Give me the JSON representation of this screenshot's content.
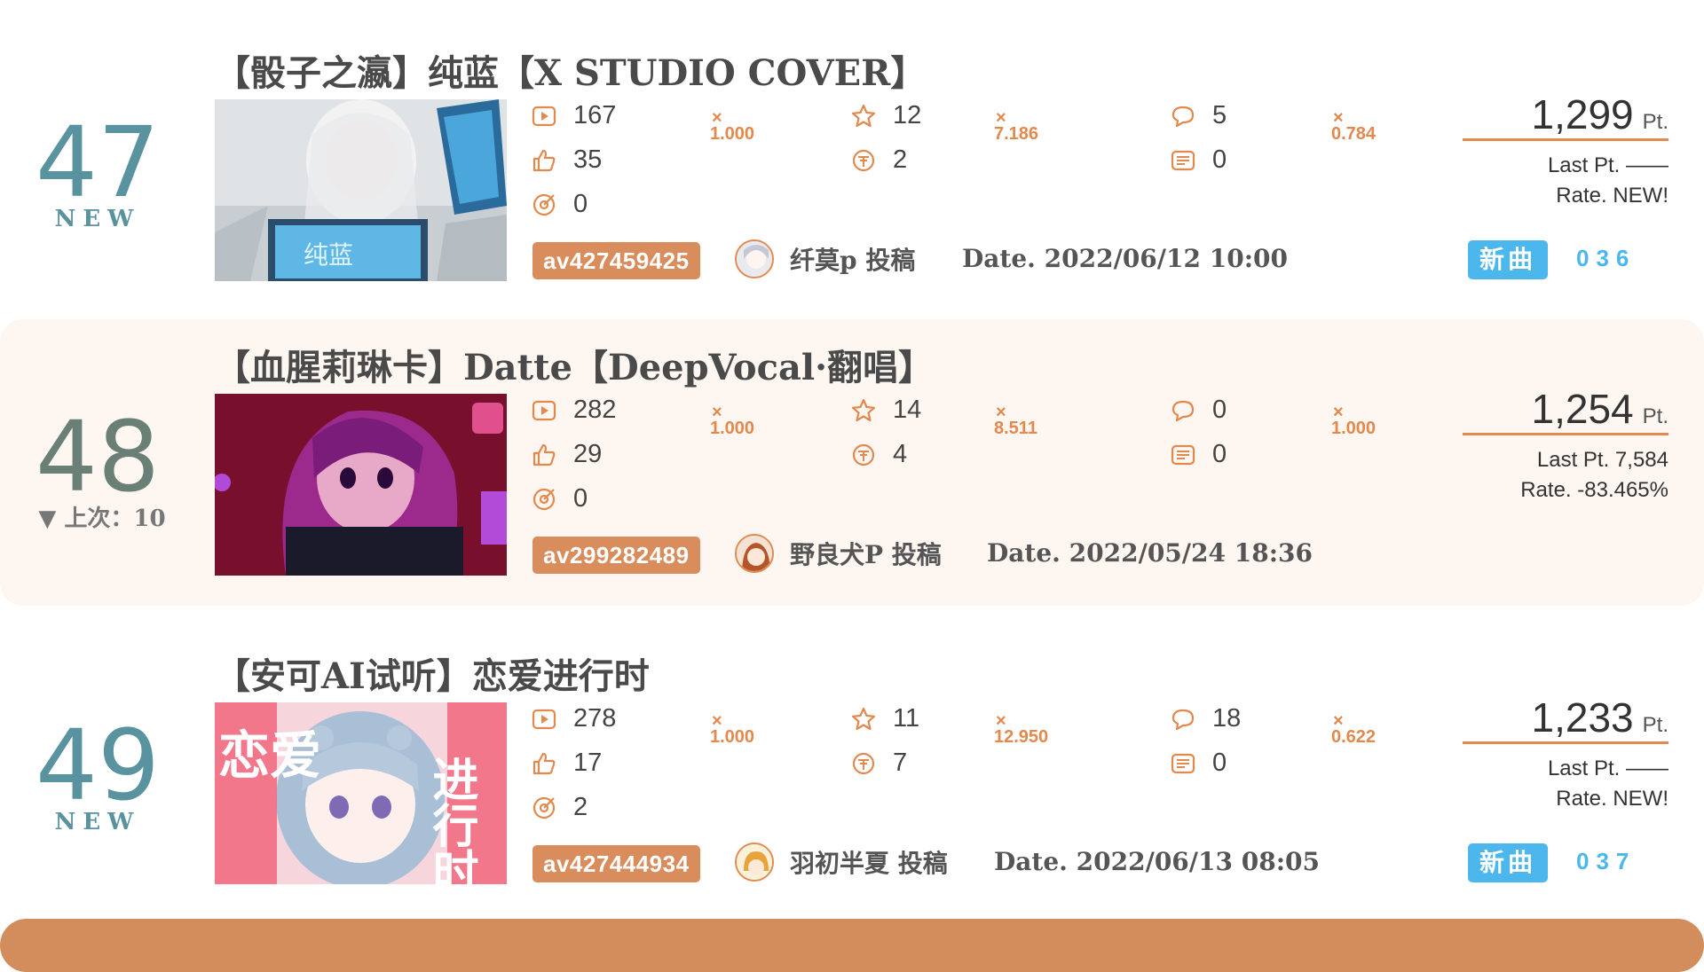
{
  "accent_color": "#e2894e",
  "entries": [
    {
      "rank": "47",
      "rank_color": "#5a93a0",
      "rank_sub": "NEW",
      "title": "【骰子之瀛】纯蓝【X STUDIO COVER】",
      "thumb_text": "纯蓝",
      "stats": {
        "views": "167",
        "views_mult": "1.000",
        "likes": "35",
        "coins_extra": "0",
        "favorites": "12",
        "favorites_mult": "7.186",
        "coins": "2",
        "comments": "5",
        "comments_mult": "0.784",
        "danmaku": "0"
      },
      "av": "av427459425",
      "uploader": "纤莫p 投稿",
      "date": "Date. 2022/06/12 10:00",
      "points": "1,299",
      "points_unit": "Pt.",
      "last_pt": "Last Pt. ——",
      "rate": "Rate. NEW!",
      "new_tag": "新曲",
      "new_index": "036"
    },
    {
      "rank": "48",
      "rank_color": "#6a7f76",
      "rank_sub": "▼ 上次：10",
      "title": "【血腥莉琳卡】Datte【DeepVocal·翻唱】",
      "stats": {
        "views": "282",
        "views_mult": "1.000",
        "likes": "29",
        "coins_extra": "0",
        "favorites": "14",
        "favorites_mult": "8.511",
        "coins": "4",
        "comments": "0",
        "comments_mult": "1.000",
        "danmaku": "0"
      },
      "av": "av299282489",
      "uploader": "野良犬P 投稿",
      "date": "Date. 2022/05/24 18:36",
      "points": "1,254",
      "points_unit": "Pt.",
      "last_pt": "Last Pt. 7,584",
      "rate": "Rate. -83.465%"
    },
    {
      "rank": "49",
      "rank_color": "#5a93a0",
      "rank_sub": "NEW",
      "title": "【安可AI试听】恋爱进行时",
      "thumb_text_left": "恋爱",
      "thumb_text_right": "进行时",
      "stats": {
        "views": "278",
        "views_mult": "1.000",
        "likes": "17",
        "coins_extra": "2",
        "favorites": "11",
        "favorites_mult": "12.950",
        "coins": "7",
        "comments": "18",
        "comments_mult": "0.622",
        "danmaku": "0"
      },
      "av": "av427444934",
      "uploader": "羽初半夏 投稿",
      "date": "Date. 2022/06/13 08:05",
      "points": "1,233",
      "points_unit": "Pt.",
      "last_pt": "Last Pt. ——",
      "rate": "Rate. NEW!",
      "new_tag": "新曲",
      "new_index": "037"
    }
  ]
}
